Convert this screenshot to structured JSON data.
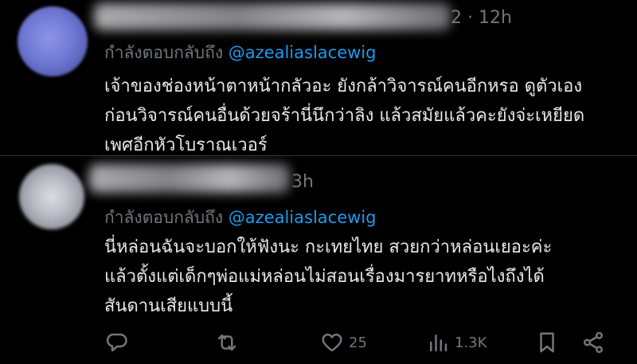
{
  "tweets": [
    {
      "time": "2 · 12h",
      "reply_prefix": "กำลังตอบกลับถึง",
      "mention": "@azealiaslacewig",
      "lines": [
        "เจ้าของช่องหน้าตาหน้ากลัวอะ ยังกล้าวิจารณ์คนอีกหรอ ดูตัวเอง",
        "ก่อนวิจารณ์คนอื่นด้วยจร้านี่นึกว่าลิง แล้วสมัยแล้วคะยังจ่ะเหยียด",
        "เพศอีกหัวโบราณเวอร์"
      ]
    },
    {
      "time": "3h",
      "reply_prefix": "กำลังตอบกลับถึง",
      "mention": "@azealiaslacewig",
      "lines": [
        "นี่หล่อนฉันจะบอกให้ฟังนะ กะเทยไทย สวยกว่าหล่อนเยอะค่ะ",
        "แล้วตั้งแต่เด็กๆพ่อแม่หล่อนไม่สอนเรื่องมารยาทหรือไงถึงได้",
        "สันดานเสียแบบนี้"
      ]
    }
  ],
  "actions": {
    "reply_icon": "reply-icon",
    "retweet_icon": "retweet-icon",
    "like_icon": "heart-icon",
    "like_count": "25",
    "views_icon": "views-icon",
    "views_count": "1.3K",
    "bookmark_icon": "bookmark-icon",
    "share_icon": "share-icon"
  },
  "colors": {
    "background": "#000000",
    "text": "#e7e9ea",
    "muted": "#71767b",
    "mention": "#1d9bf0"
  }
}
